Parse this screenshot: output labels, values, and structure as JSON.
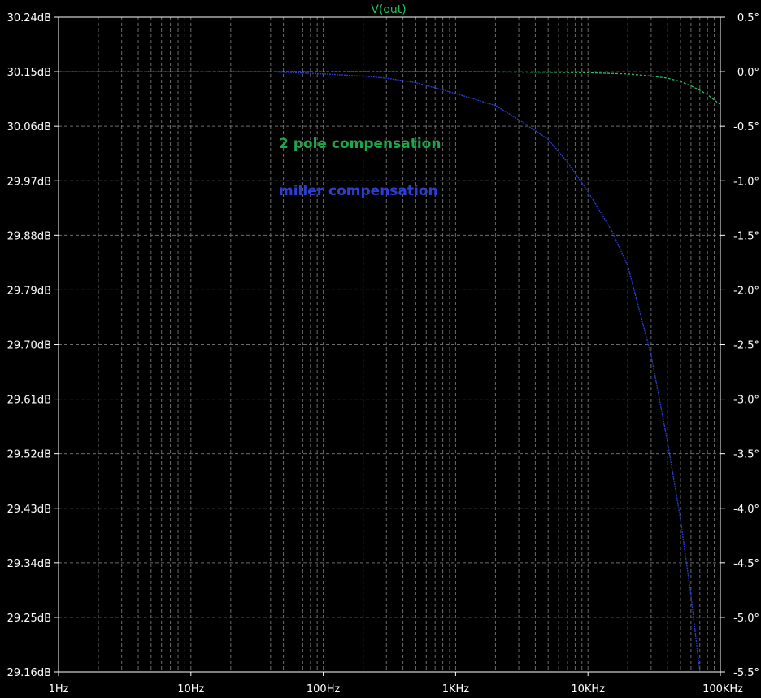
{
  "chart_data": {
    "type": "line",
    "title": "V(out)",
    "x_scale": "log",
    "xlim": [
      1,
      100000
    ],
    "x_tick_labels": [
      "1Hz",
      "10Hz",
      "100Hz",
      "1KHz",
      "10KHz",
      "100KHz"
    ],
    "y_left_ticks": [
      "30.24dB",
      "30.15dB",
      "30.06dB",
      "29.97dB",
      "29.88dB",
      "29.79dB",
      "29.70dB",
      "29.61dB",
      "29.52dB",
      "29.43dB",
      "29.34dB",
      "29.25dB",
      "29.16dB"
    ],
    "y_right_ticks": [
      "0.5°",
      "0.0°",
      "-0.5°",
      "-1.0°",
      "-1.5°",
      "-2.0°",
      "-2.5°",
      "-3.0°",
      "-3.5°",
      "-4.0°",
      "-4.5°",
      "-5.0°",
      "-5.5°"
    ],
    "ylim_db": [
      29.16,
      30.24
    ],
    "ylim_phase_deg": [
      -5.5,
      0.5
    ],
    "grid": true,
    "annotations": [
      {
        "text": "2 pole compensation",
        "color": "#1fa64a"
      },
      {
        "text": "miller compensation",
        "color": "#2b3fd6"
      }
    ],
    "series": [
      {
        "color": "#22c55e",
        "axis": "phase",
        "x": [
          1,
          10,
          100,
          1000,
          5000,
          10000,
          20000,
          30000,
          40000,
          50000,
          60000,
          70000,
          80000,
          90000,
          100000
        ],
        "y": [
          0,
          0,
          0,
          0,
          -0.005,
          -0.01,
          -0.02,
          -0.04,
          -0.06,
          -0.09,
          -0.13,
          -0.17,
          -0.21,
          -0.26,
          -0.3
        ]
      },
      {
        "color": "#2b3fd6",
        "axis": "phase",
        "x": [
          1,
          10,
          40,
          100,
          200,
          300,
          500,
          1000,
          2000,
          3000,
          5000,
          7000,
          10000,
          15000,
          20000,
          30000,
          40000,
          50000,
          60000,
          70000
        ],
        "y": [
          0,
          0,
          0,
          -0.02,
          -0.04,
          -0.06,
          -0.1,
          -0.2,
          -0.31,
          -0.44,
          -0.62,
          -0.83,
          -1.1,
          -1.45,
          -1.78,
          -2.6,
          -3.4,
          -4.1,
          -4.8,
          -5.5
        ]
      }
    ]
  }
}
